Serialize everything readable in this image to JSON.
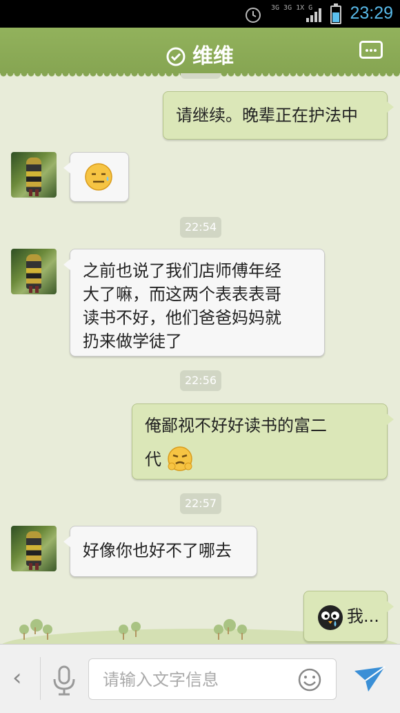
{
  "status_bar": {
    "time": "23:29",
    "network_label": "3G 3G 1X G",
    "icons": [
      "alarm-icon",
      "signal-icon",
      "battery-icon"
    ],
    "colors": {
      "time": "#58b9e8"
    }
  },
  "header": {
    "title": "维维",
    "icons": [
      "check-circle-icon",
      "more-icon"
    ],
    "colors": {
      "bar": "#8cab57"
    }
  },
  "messages": [
    {
      "side": "out",
      "type": "text",
      "text": "请继续。晚辈正在护法中"
    },
    {
      "side": "in",
      "type": "emoji",
      "emoji": "sweat-smile-emoji"
    },
    {
      "side": "time",
      "text": "22:54"
    },
    {
      "side": "in",
      "type": "text",
      "lines": [
        "之前也说了我们店师傅年经",
        "大了嘛，而这两个表表表哥",
        "读书不好，他们爸爸妈妈就",
        "扔来做学徒了"
      ]
    },
    {
      "side": "time",
      "text": "22:56"
    },
    {
      "side": "out",
      "type": "text",
      "lines": [
        "俺鄙视不好好读书的富二",
        "代"
      ],
      "emoji": "smug-emoji"
    },
    {
      "side": "time",
      "text": "22:57"
    },
    {
      "side": "in",
      "type": "text",
      "text": "好像你也好不了哪去"
    },
    {
      "side": "out",
      "type": "text",
      "text": "我...",
      "emoji": "crying-bird-emoji"
    }
  ],
  "input_bar": {
    "back_label": "‹",
    "placeholder": "请输入文字信息",
    "icons": [
      "back-icon",
      "microphone-icon",
      "emoji-icon",
      "send-icon"
    ],
    "colors": {
      "send": "#3a8fd6"
    }
  }
}
